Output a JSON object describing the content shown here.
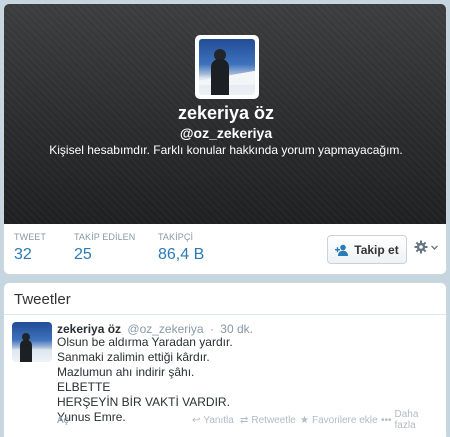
{
  "profile": {
    "name": "zekeriya öz",
    "handle": "@oz_zekeriya",
    "bio": "Kişisel hesabımdır. Farklı konular hakkında yorum yapmayacağım.",
    "stats": [
      {
        "label": "TWEET",
        "value": "32"
      },
      {
        "label": "TAKİP EDİLEN",
        "value": "25"
      },
      {
        "label": "TAKİPÇİ",
        "value": "86,4 B"
      }
    ],
    "follow_label": "Takip et",
    "gear_icon": "gear-icon",
    "colors": {
      "link": "#2a7ab7",
      "muted": "#8899a6",
      "header_bg": "#2c2e30"
    }
  },
  "tweets": {
    "title": "Tweetler",
    "items": [
      {
        "author": "zekeriya öz",
        "handle": "@oz_zekeriya",
        "separator": "·",
        "time": "30 dk.",
        "lines": [
          "Olsun be aldırma Yaradan yardır.",
          "Sanmaki zalimin ettiği kârdır.",
          "Mazlumun ahı indirir şâhı.",
          "ELBETTE",
          "HERŞEYİN BİR VAKTİ VARDIR.",
          "Yunus Emre."
        ],
        "actions": {
          "expand": "Aç",
          "reply": "Yanıtla",
          "retweet": "Retweetle",
          "favorite": "Favorilere ekle",
          "more": "Daha fazla"
        }
      }
    ]
  }
}
